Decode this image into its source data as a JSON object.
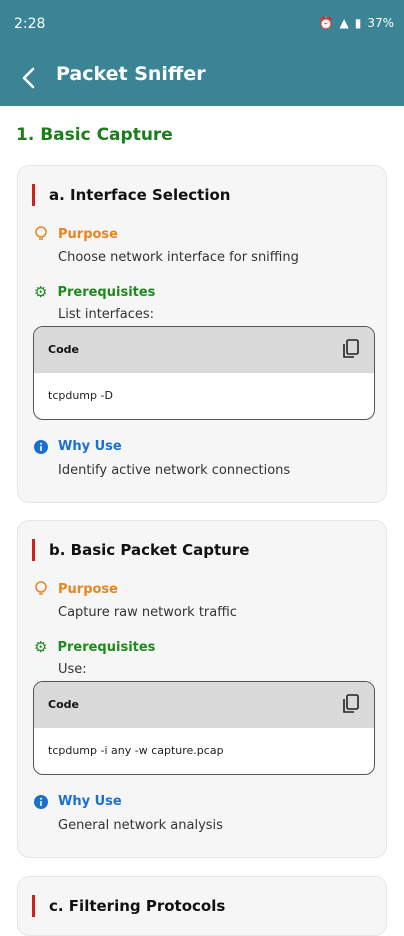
{
  "status": {
    "time": "2:28",
    "battery": "37%"
  },
  "appbar": {
    "title": "Packet Sniffer"
  },
  "section": {
    "title": "1. Basic Capture"
  },
  "labels": {
    "purpose": "Purpose",
    "prereq": "Prerequisites",
    "code": "Code",
    "why": "Why Use"
  },
  "colors": {
    "appbar": "#3b8496",
    "section": "#1b7d1b",
    "purpose": "#e8851e",
    "prereq": "#1e8a1e",
    "why": "#1a6fd1",
    "accent_bar": "#d01f1f"
  },
  "cards": [
    {
      "title": "a. Interface Selection",
      "purpose": "Choose network interface for sniffing",
      "prereq": "List interfaces:",
      "code": "tcpdump -D",
      "why": "Identify active network connections"
    },
    {
      "title": "b. Basic Packet Capture",
      "purpose": "Capture raw network traffic",
      "prereq": "Use:",
      "code": "tcpdump -i any -w capture.pcap",
      "why": "General network analysis"
    },
    {
      "title": "c. Filtering Protocols"
    }
  ]
}
